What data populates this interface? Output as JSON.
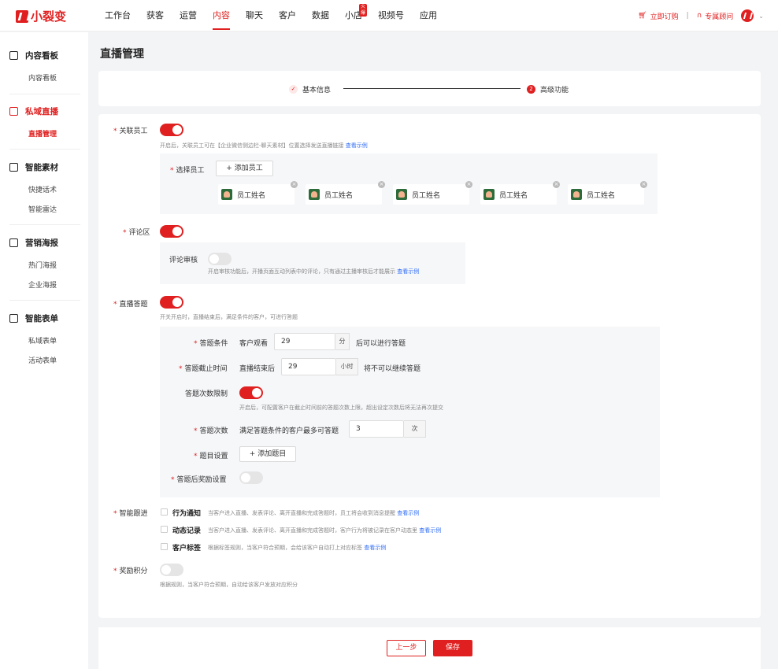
{
  "app": {
    "logo_text": "小裂变",
    "brand_color": "#e02020",
    "link_color": "#2f6cf6"
  },
  "nav": {
    "items": [
      "工作台",
      "获客",
      "运营",
      "内容",
      "聊天",
      "客户",
      "数据",
      "小店",
      "视频号",
      "应用"
    ],
    "active": "内容",
    "hot_badge": "火爆",
    "subscribe": "立即订购",
    "consultant": "专属顾问"
  },
  "sidebar": {
    "groups": [
      {
        "title": "内容看板",
        "items": [
          "内容看板"
        ]
      },
      {
        "title": "私域直播",
        "items": [
          "直播管理"
        ]
      },
      {
        "title": "智能素材",
        "items": [
          "快捷话术",
          "智能雷达"
        ]
      },
      {
        "title": "营销海报",
        "items": [
          "热门海报",
          "企业海报"
        ]
      },
      {
        "title": "智能表单",
        "items": [
          "私域表单",
          "活动表单"
        ]
      }
    ]
  },
  "page": {
    "title": "直播管理"
  },
  "steps": {
    "step1": "基本信息",
    "step1_icon": "check-icon",
    "step2_num": "2",
    "step2": "高级功能"
  },
  "form": {
    "link_employee": {
      "label": "关联员工",
      "enabled": true,
      "hint": "开启后，关联员工可在【企业微信侧边栏-聊天素材】位置选择发送直播链接",
      "hint_link": "查看示例",
      "select_label": "选择员工",
      "add_button": "+ 添加员工",
      "employees": [
        "员工姓名",
        "员工姓名",
        "员工姓名",
        "员工姓名",
        "员工姓名"
      ]
    },
    "comment": {
      "label": "评论区",
      "enabled": true,
      "review_label": "评论审核",
      "review_enabled": false,
      "review_hint": "开启审核功能后，开播页面互动列表中的评论，只有通过主播审核后才能展示",
      "review_link": "查看示例"
    },
    "quiz": {
      "label": "直播答题",
      "enabled": true,
      "hint": "开关开启时，直播结束后，满足条件的客户，可进行答题",
      "condition_label": "答题条件",
      "condition_prefix": "客户观看",
      "condition_value": "29",
      "condition_unit": "分",
      "condition_suffix": "后可以进行答题",
      "deadline_label": "答题截止时间",
      "deadline_prefix": "直播结束后",
      "deadline_value": "29",
      "deadline_unit": "小时",
      "deadline_suffix": "将不可以继续答题",
      "limit_label": "答题次数限制",
      "limit_enabled": true,
      "limit_hint": "开启后，可配置客户在截止时间前的答题次数上限，超出设定次数后将无法再次提交",
      "times_label": "答题次数",
      "times_prefix": "满足答题条件的客户最多可答题",
      "times_value": "3",
      "times_unit": "次",
      "question_label": "题目设置",
      "add_question": "+ 添加题目",
      "reward_label": "答题后奖励设置",
      "reward_enabled": false
    },
    "follow": {
      "label": "智能跟进",
      "options": [
        {
          "title": "行为通知",
          "desc": "当客户进入直播、发表评论、离开直播和完成答题时，员工将会收到消息提醒",
          "link": "查看示例",
          "checked": false
        },
        {
          "title": "动态记录",
          "desc": "当客户进入直播、发表评论、离开直播和完成答题时，客户行为将被记录在客户动态里",
          "link": "查看示例",
          "checked": false
        },
        {
          "title": "客户标签",
          "desc": "根据标签规则，当客户符合预期，会给该客户自动打上对应标签",
          "link": "查看示例",
          "checked": false
        }
      ]
    },
    "points": {
      "label": "奖励积分",
      "enabled": false,
      "hint": "根据规则，当客户符合预期，自动给该客户发放对应积分"
    }
  },
  "footer": {
    "prev": "上一步",
    "save": "保存"
  }
}
